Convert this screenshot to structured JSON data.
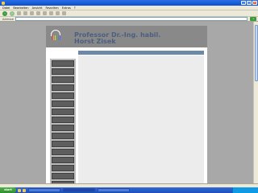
{
  "browser": {
    "title": "",
    "menu": [
      "Datei",
      "Bearbeiten",
      "Ansicht",
      "Favoriten",
      "Extras",
      "?"
    ],
    "address_label": "Adresse",
    "go_label": "Wechseln zu",
    "status": "",
    "colors": {
      "titlebar": "#0b4fd0",
      "chrome": "#ece9d8",
      "viewport": "#a8a8a8"
    }
  },
  "page": {
    "header_title_line1": "Professor Dr.-Ing. habil.",
    "header_title_line2": "Horst Zisek",
    "logo_text": "",
    "logo_bar_colors": [
      "#d94c4c",
      "#e9a23b",
      "#e2d34a",
      "#5bb35b",
      "#4a86d6",
      "#8c5bd6"
    ],
    "colors": {
      "header": "#898989",
      "title": "#4b5f80",
      "nav": "#5e5e5e",
      "content_head": "#6c8aa8"
    },
    "nav": [
      "",
      "",
      "",
      "",
      "",
      "",
      "",
      "",
      "",
      "",
      "",
      "",
      "",
      "",
      "",
      "",
      ""
    ],
    "content_header": "",
    "content_title": "",
    "bullets": [
      "",
      "",
      "",
      "",
      "",
      "",
      "",
      "",
      "",
      "",
      "",
      "",
      "",
      "",
      "",
      "",
      "",
      "",
      "",
      "",
      "",
      "",
      ""
    ]
  },
  "taskbar": {
    "start_label": "start",
    "clock": ""
  }
}
